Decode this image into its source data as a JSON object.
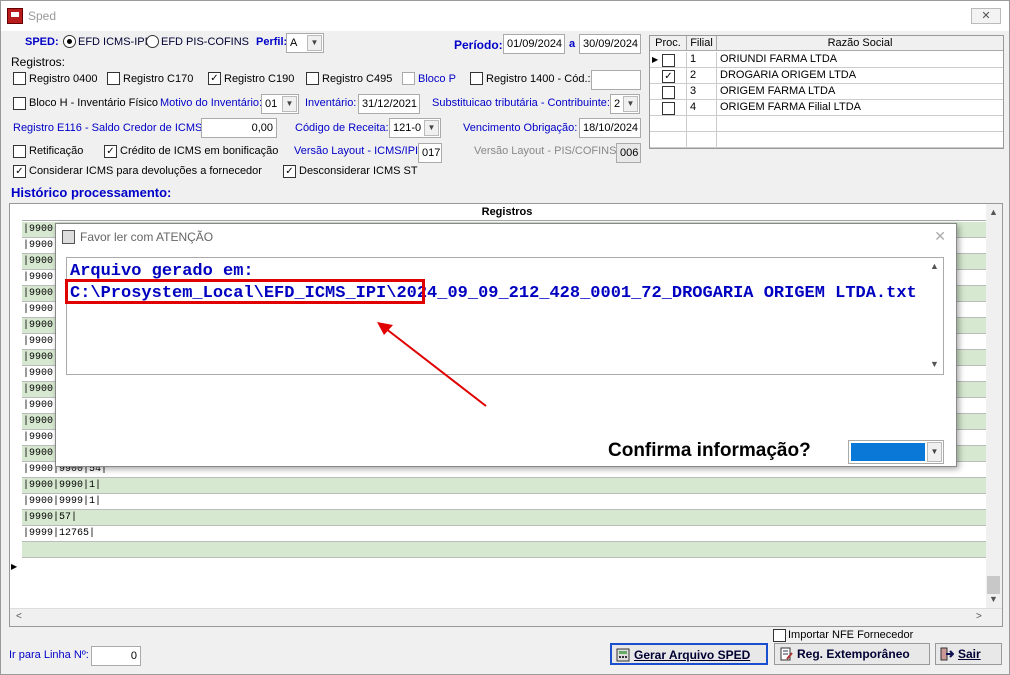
{
  "window": {
    "title": "Sped",
    "close": "✕"
  },
  "sped": {
    "label": "SPED:",
    "opt1": "EFD ICMS-IPI",
    "opt2": "EFD PIS-COFINS",
    "perfil_label": "Perfil:",
    "perfil": "A"
  },
  "periodo": {
    "label": "Período:",
    "from": "01/09/2024",
    "sep": "a",
    "to": "30/09/2024"
  },
  "registros": {
    "label": "Registros:",
    "r0400": "Registro 0400",
    "c170": "Registro C170",
    "c190": "Registro C190",
    "c495": "Registro C495",
    "blocop": "Bloco P",
    "r1400": "Registro 1400 - Cód.:",
    "r1400_val": ""
  },
  "blocoh": {
    "label": "Bloco H - Inventário Físico",
    "motivo_label": "Motivo do Inventário:",
    "motivo": "01",
    "inv_label": "Inventário:",
    "inv": "31/12/2021",
    "subst_label": "Substituicao tributária - Contribuinte:",
    "subst": "2"
  },
  "e116": {
    "label": "Registro E116 - Saldo Credor de ICMS:",
    "value": "0,00",
    "codrec_label": "Código de Receita:",
    "codrec": "121-0",
    "venc_label": "Vencimento Obrigação:",
    "venc": "18/10/2024"
  },
  "opts": {
    "retif": "Retificação",
    "credito": "Crédito de ICMS em bonificação",
    "versao_label": "Versão Layout - ICMS/IPI:",
    "versao": "017",
    "versao2_label": "Versão Layout - PIS/COFINS:",
    "versao2": "006",
    "considerar": "Considerar ICMS para devoluções a fornecedor",
    "desconsiderar": "Desconsiderar ICMS ST"
  },
  "filiais": {
    "headers": [
      "Proc.",
      "Filial",
      "Razão Social"
    ],
    "rows": [
      {
        "filial": "1",
        "razao": "ORIUNDI FARMA LTDA",
        "checked": false
      },
      {
        "filial": "2",
        "razao": "DROGARIA ORIGEM LTDA",
        "checked": true
      },
      {
        "filial": "3",
        "razao": "ORIGEM FARMA LTDA",
        "checked": false
      },
      {
        "filial": "4",
        "razao": "ORIGEM FARMA Filial LTDA",
        "checked": false
      }
    ]
  },
  "historico": {
    "label": "Histórico processamento:",
    "header": "Registros",
    "rows": [
      "|9900",
      "|9900",
      "|9900",
      "|9900",
      "|9900",
      "|9900",
      "|9900",
      "|9900",
      "|9900",
      "|9900",
      "|9900",
      "|9900",
      "|9900",
      "|9900",
      "|9900|9001|1|",
      "|9900|9900|54|",
      "|9900|9990|1|",
      "|9900|9999|1|",
      "|9990|57|",
      "|9999|12765|",
      ""
    ]
  },
  "bottom": {
    "importar": "Importar NFE Fornecedor",
    "irpara_label": "Ir para Linha Nº:",
    "irpara": "0",
    "gerar": "Gerar Arquivo SPED",
    "reg": "Reg. Extemporâneo",
    "sair": "Sair"
  },
  "dialog": {
    "title": "Favor ler com ATENÇÃO",
    "message": "Arquivo gerado em:\nC:\\Prosystem_Local\\EFD_ICMS_IPI\\2024_09_09_212_428_0001_72_DROGARIA ORIGEM LTDA.txt",
    "confirm": "Confirma informação?",
    "confirm_value": ""
  }
}
